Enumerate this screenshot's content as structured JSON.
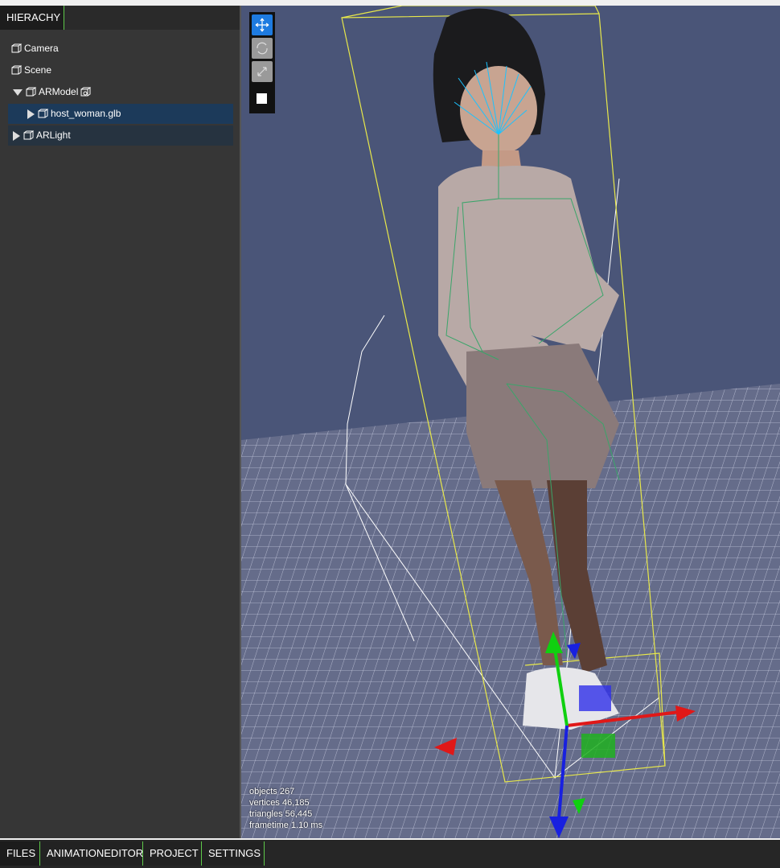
{
  "hierarchy": {
    "tab_label": "HIERACHY",
    "items": [
      {
        "label": "Camera"
      },
      {
        "label": "Scene"
      },
      {
        "label": "ARModel"
      },
      {
        "label": "host_woman.glb"
      },
      {
        "label": "ARLight"
      }
    ]
  },
  "viewport": {
    "tools": [
      "move-tool",
      "rotate-tool",
      "scale-tool",
      "toggle-box"
    ],
    "stats": {
      "objects": "objects  267",
      "vertices": "vertices  46,185",
      "triangles": "triangles  56,445",
      "frametime": "frametime  1.10 ms"
    }
  },
  "bottom_tabs": [
    "FILES",
    "ANIMATIONEDITOR",
    "PROJECT",
    "SETTINGS"
  ],
  "colors": {
    "sidebar_bg": "#363636",
    "viewport_sky": "#4a5578",
    "grid_floor": "#6a718e",
    "selection": "#1c3a5a",
    "tab_accent": "#5ec94a",
    "tool_active": "#1e7be0"
  }
}
